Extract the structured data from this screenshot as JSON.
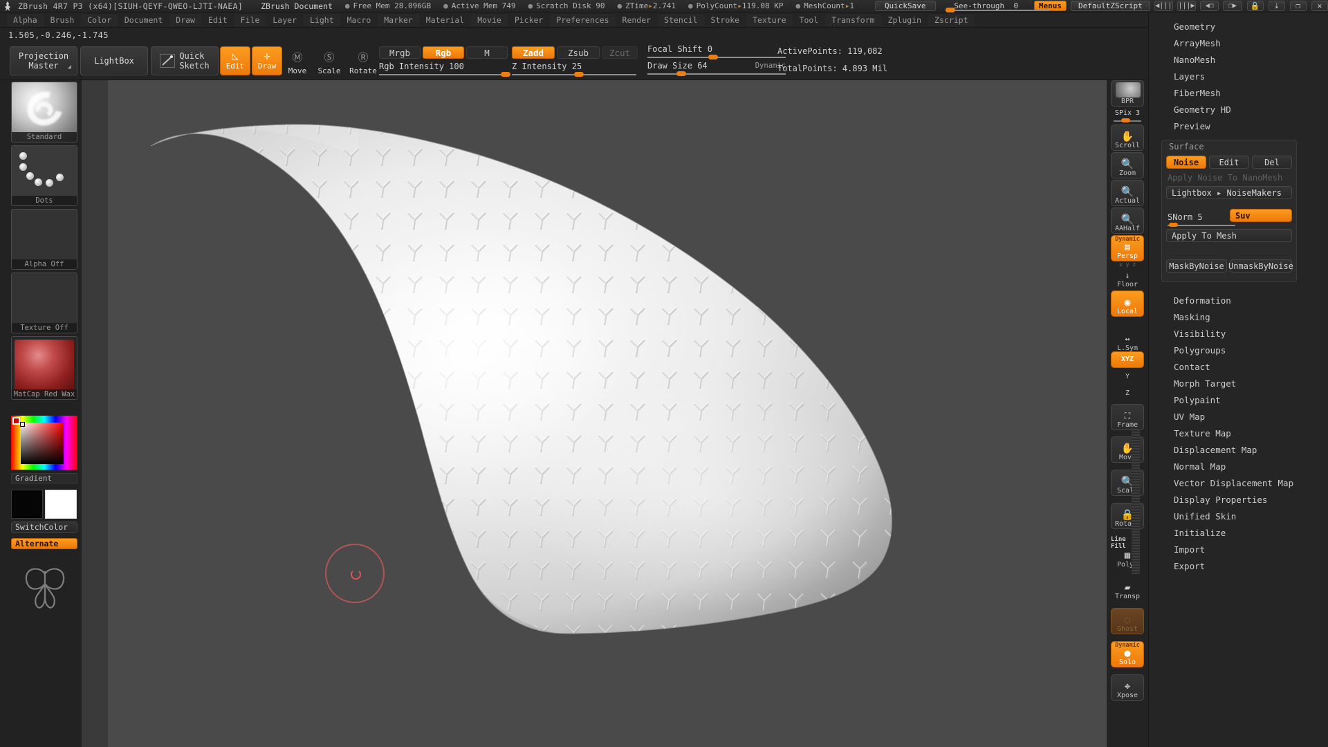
{
  "titlebar": {
    "app_title": "ZBrush 4R7 P3 (x64)[SIUH-QEYF-QWEO-LJTI-NAEA]",
    "document_title": "ZBrush Document",
    "stats": [
      {
        "label": "Free Mem",
        "value": "28.096GB"
      },
      {
        "label": "Active Mem",
        "value": "749"
      },
      {
        "label": "Scratch Disk",
        "value": "90"
      },
      {
        "label": "ZTime",
        "value": "2.741",
        "arrow": true
      },
      {
        "label": "PolyCount",
        "value": "119.08 KP",
        "arrow": true
      },
      {
        "label": "MeshCount",
        "value": "1",
        "arrow": true
      }
    ],
    "quicksave_label": "QuickSave",
    "seethrough_label": "See-through",
    "seethrough_value": "0",
    "menus_label": "Menus",
    "zscript_label": "DefaultZScript",
    "nav_prev": "◀|||",
    "nav_next": "|||▶",
    "doc_prev": "◀❐",
    "doc_next": "❐▶",
    "lock_icon": "🔒",
    "minimize": "⤓",
    "restore": "❐",
    "close": "✕"
  },
  "menubar": {
    "items": [
      "Alpha",
      "Brush",
      "Color",
      "Document",
      "Draw",
      "Edit",
      "File",
      "Layer",
      "Light",
      "Macro",
      "Marker",
      "Material",
      "Movie",
      "Picker",
      "Preferences",
      "Render",
      "Stencil",
      "Stroke",
      "Texture",
      "Tool",
      "Transform",
      "Zplugin",
      "Zscript"
    ]
  },
  "toolbar": {
    "coords": "1.505,-0.246,-1.745",
    "projection_master": "Projection\nMaster",
    "lightbox": "LightBox",
    "quick_sketch": "Quick\nSketch",
    "edit": "Edit",
    "draw": "Draw",
    "move": "Move",
    "scale": "Scale",
    "rotate": "Rotate",
    "mrgb": "Mrgb",
    "rgb": "Rgb",
    "m": "M",
    "zadd": "Zadd",
    "zsub": "Zsub",
    "zcut": "Zcut",
    "rgb_intensity_label": "Rgb Intensity",
    "rgb_intensity_value": "100",
    "z_intensity_label": "Z Intensity",
    "z_intensity_value": "25",
    "focal_shift_label": "Focal Shift",
    "focal_shift_value": "0",
    "draw_size_label": "Draw Size",
    "draw_size_value": "64",
    "dynamic": "Dynamic",
    "active_points": "ActivePoints: 119,082",
    "total_points": "TotalPoints: 4.893 Mil"
  },
  "leftpanel": {
    "brush": "Standard",
    "stroke": "Dots",
    "alpha": "Alpha Off",
    "texture": "Texture Off",
    "material": "MatCap Red Wax",
    "gradient": "Gradient",
    "switchcolor": "SwitchColor",
    "alternate": "Alternate"
  },
  "rail": {
    "bpr": "BPR",
    "spix_label": "SPix",
    "spix_value": "3",
    "items": [
      {
        "name": "Scroll",
        "glyph": "✋"
      },
      {
        "name": "Zoom",
        "glyph": "🔍"
      },
      {
        "name": "Actual",
        "glyph": "🔍"
      },
      {
        "name": "AAHalf",
        "glyph": "🔍"
      },
      {
        "name": "Persp",
        "glyph": "▤",
        "badge": "Dynamic",
        "active": true
      },
      {
        "name": "Floor",
        "glyph": "↓"
      },
      {
        "name": "Local",
        "glyph": "◉",
        "active": true
      },
      {
        "name": "L.Sym",
        "glyph": "↔"
      },
      {
        "name": "XYZ",
        "glyph": "↻",
        "active": true
      },
      {
        "name": "Y",
        "glyph": "↻"
      },
      {
        "name": "Z",
        "glyph": "↻"
      },
      {
        "name": "Frame",
        "glyph": "⛶"
      },
      {
        "name": "Move",
        "glyph": "✋"
      },
      {
        "name": "Scale",
        "glyph": "🔍"
      },
      {
        "name": "Rotate",
        "glyph": "🔒"
      },
      {
        "name": "PolyF",
        "glyph": "▦",
        "badge": "Line Fill"
      },
      {
        "name": "Transp",
        "glyph": "▰"
      },
      {
        "name": "Ghost",
        "glyph": "◌"
      },
      {
        "name": "Solo",
        "glyph": "●",
        "badge": "Dynamic",
        "active": true
      },
      {
        "name": "Xpose",
        "glyph": "✥"
      }
    ]
  },
  "rightpanel": {
    "items_top": [
      "Geometry",
      "ArrayMesh",
      "NanoMesh",
      "Layers",
      "FiberMesh",
      "Geometry HD",
      "Preview"
    ],
    "surface": {
      "title": "Surface",
      "noise": "Noise",
      "edit": "Edit",
      "del": "Del",
      "apply_noise_to_nanomesh": "Apply Noise To NanoMesh",
      "lightbox_noisemakers": "Lightbox ▸ NoiseMakers",
      "snorm_label": "SNorm",
      "snorm_value": "5",
      "suv": "Suv",
      "apply_to_mesh": "Apply To Mesh",
      "mask_by_noise": "MaskByNoise",
      "unmask_by_noise": "UnmaskByNoise"
    },
    "items_bottom": [
      "Deformation",
      "Masking",
      "Visibility",
      "Polygroups",
      "Contact",
      "Morph Target",
      "Polypaint",
      "UV Map",
      "Texture Map",
      "Displacement Map",
      "Normal Map",
      "Vector Displacement Map",
      "Display Properties",
      "Unified Skin",
      "Initialize",
      "Import",
      "Export"
    ]
  },
  "colors": {
    "accent": "#f07d10",
    "panel_bg": "#252525",
    "canvas_bg": "#4a4a4a",
    "text": "#cdcdcd"
  }
}
